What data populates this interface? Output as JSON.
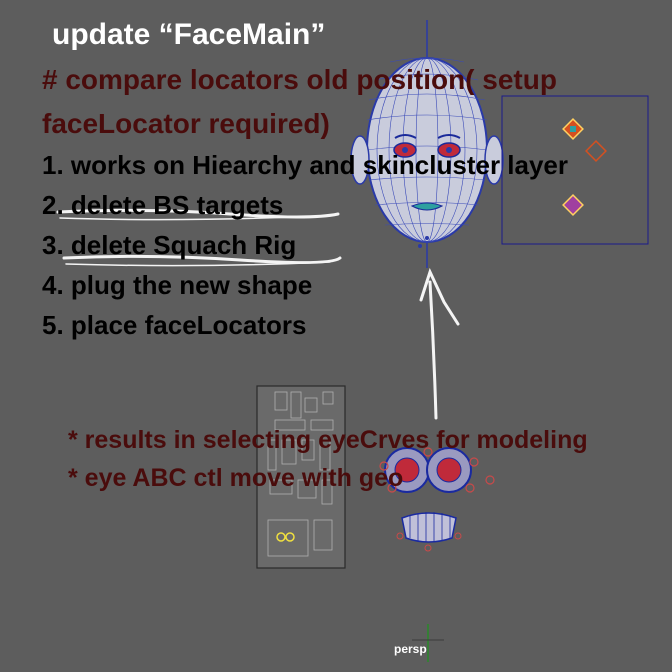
{
  "title": "update “FaceMain”",
  "comment": {
    "line1": "# compare locators old position( setup",
    "line2": "faceLocator required)"
  },
  "steps": [
    "1. works on Hiearchy and skincluster layer",
    "2. delete BS targets",
    "3. delete Squach Rig",
    "4. plug the new shape",
    "5. place faceLocators"
  ],
  "notes": [
    "* results in selecting eyeCrves for modeling",
    "* eye ABC ctl move with geo"
  ],
  "camera_label": "persp",
  "colors": {
    "viewport_bg": "#5d5d5d",
    "comment_text": "#4a0c0c",
    "mesh_wire": "#2a3aa8",
    "chalk": "#f4f4f4"
  }
}
